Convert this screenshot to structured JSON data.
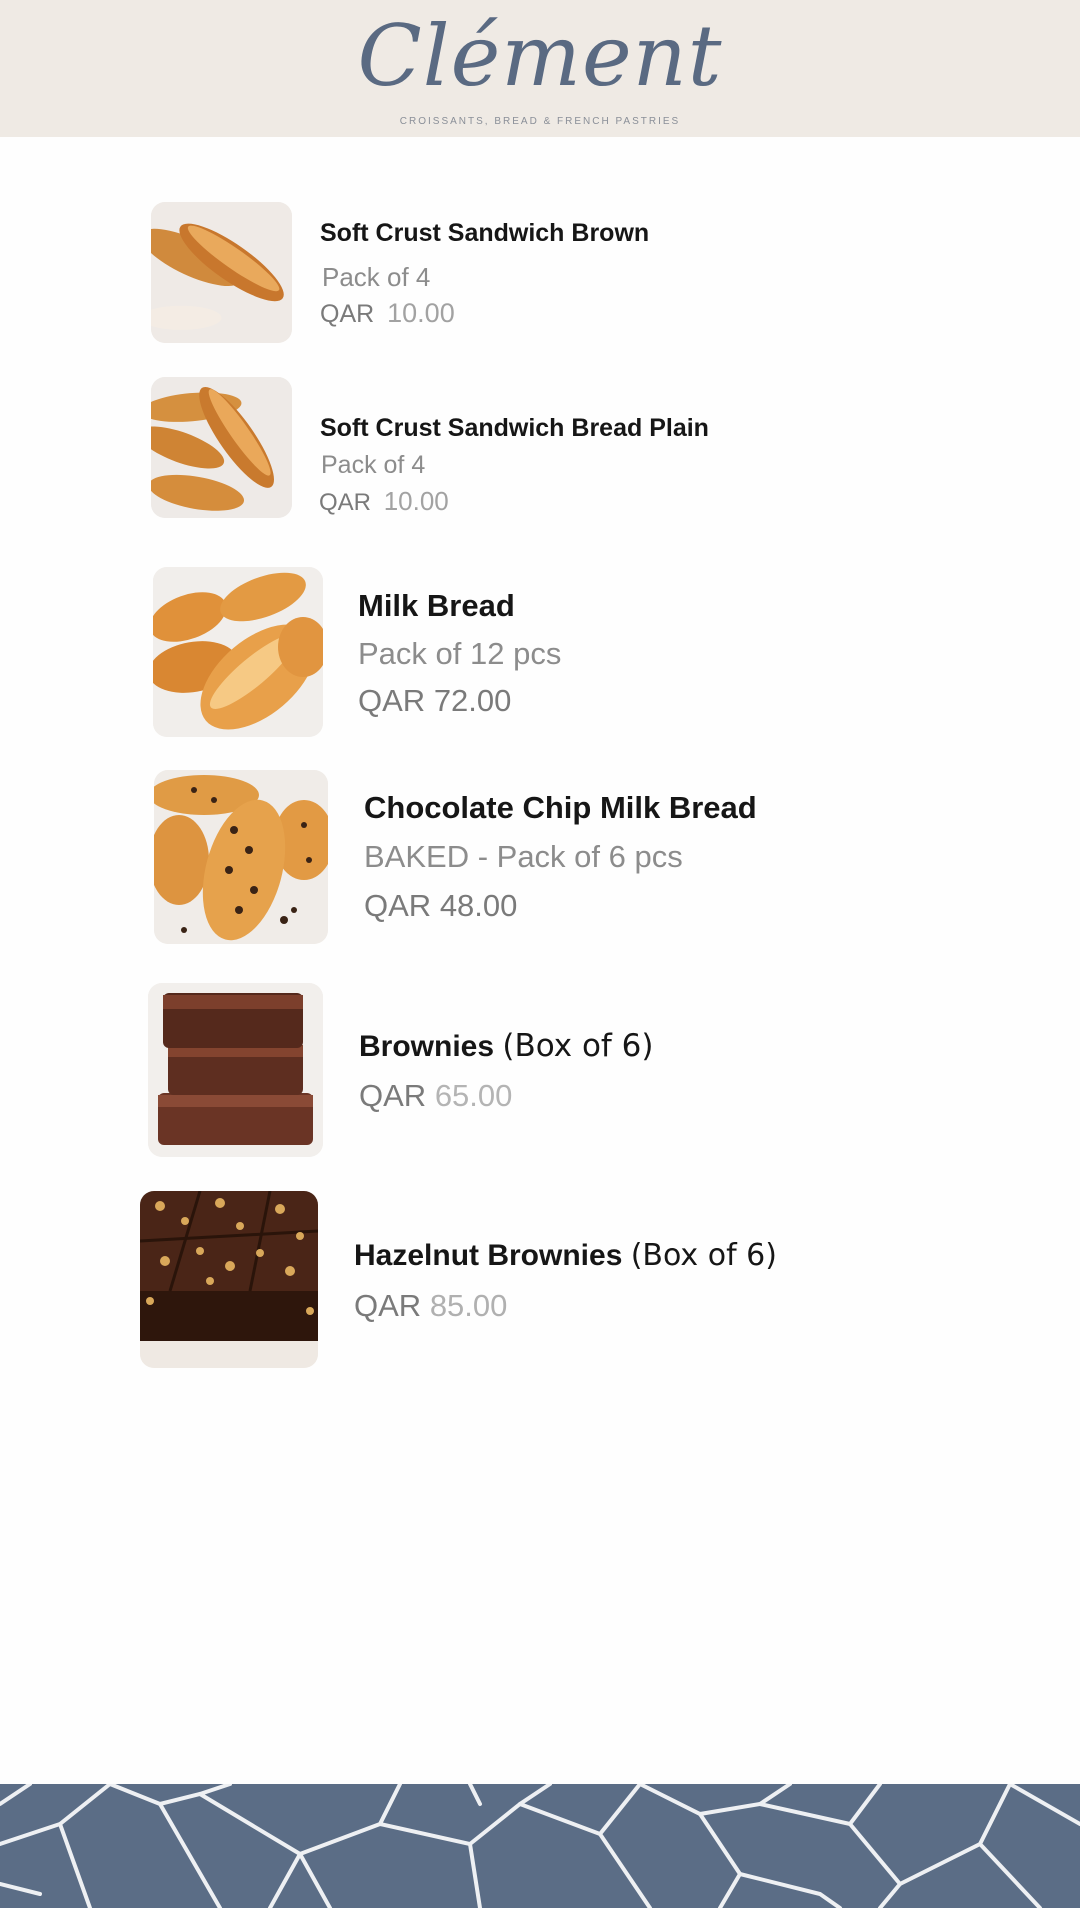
{
  "brand": {
    "name": "Clément",
    "tagline": "CROISSANTS, BREAD & FRENCH PASTRIES"
  },
  "colors": {
    "header_bg": "#efeae4",
    "logo": "#5a6a82",
    "footer_bg": "#5b6d86",
    "footer_lines": "#eef0f3"
  },
  "products": [
    {
      "name": "Soft Crust Sandwich Brown",
      "pack": "Pack of 4",
      "currency": "QAR",
      "amount": "10.00",
      "image": "bread-rolls-image"
    },
    {
      "name": "Soft Crust Sandwich Bread Plain",
      "pack": "Pack of 4",
      "currency": "QAR",
      "amount": "10.00",
      "image": "bread-rolls-image"
    },
    {
      "name": "Milk Bread",
      "pack": "Pack of 12 pcs",
      "currency": "QAR",
      "amount": "72.00",
      "image": "milk-bread-image"
    },
    {
      "name": "Chocolate Chip Milk Bread",
      "pack": "BAKED - Pack of 6 pcs",
      "currency": "QAR",
      "amount": "48.00",
      "image": "chocolate-chip-bread-image"
    },
    {
      "name": "Brownies",
      "name_suffix": "(Box of 6)",
      "currency": "QAR",
      "amount": "65.00",
      "image": "brownies-image"
    },
    {
      "name": "Hazelnut Brownies",
      "name_suffix": "(Box of 6)",
      "currency": "QAR",
      "amount": "85.00",
      "image": "hazelnut-brownies-image"
    }
  ]
}
